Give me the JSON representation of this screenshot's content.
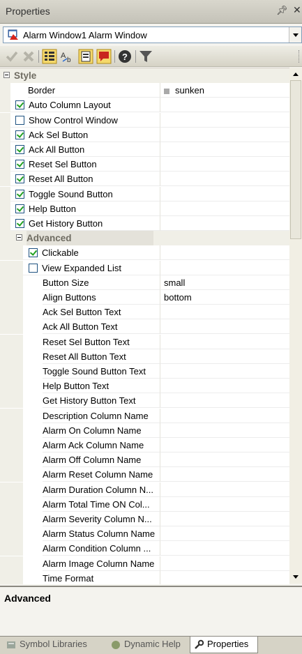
{
  "panel": {
    "title": "Properties",
    "pin_glyph": "p",
    "close_glyph": "×"
  },
  "object_selector": {
    "value": "Alarm Window1 Alarm Window"
  },
  "toolbar": {
    "icons": [
      "check-icon",
      "cross-icon",
      "categorized-icon",
      "alphabetical-icon",
      "properties-icon",
      "events-icon",
      "help-icon",
      "filter-icon"
    ]
  },
  "grid": {
    "style_header": "Style",
    "border_label": "Border",
    "border_value": "sunken",
    "checks": [
      {
        "label": "Auto Column Layout",
        "checked": true
      },
      {
        "label": "Show Control Window",
        "checked": false
      },
      {
        "label": "Ack Sel Button",
        "checked": true
      },
      {
        "label": "Ack All Button",
        "checked": true
      },
      {
        "label": "Reset Sel Button",
        "checked": true
      },
      {
        "label": "Reset All Button",
        "checked": true
      },
      {
        "label": "Toggle Sound Button",
        "checked": true
      },
      {
        "label": "Help Button",
        "checked": true
      },
      {
        "label": "Get History Button",
        "checked": true
      }
    ],
    "advanced_header": "Advanced",
    "adv_checks": [
      {
        "label": "Clickable",
        "checked": true
      },
      {
        "label": "View Expanded List",
        "checked": false
      }
    ],
    "adv_props": [
      {
        "label": "Button Size",
        "value": "small"
      },
      {
        "label": "Align Buttons",
        "value": "bottom"
      },
      {
        "label": "Ack Sel Button Text",
        "value": ""
      },
      {
        "label": "Ack All Button Text",
        "value": ""
      },
      {
        "label": "Reset Sel Button Text",
        "value": ""
      },
      {
        "label": "Reset All Button Text",
        "value": ""
      },
      {
        "label": "Toggle Sound Button Text",
        "value": ""
      },
      {
        "label": "Help Button Text",
        "value": ""
      },
      {
        "label": "Get History Button Text",
        "value": ""
      },
      {
        "label": "Description Column Name",
        "value": ""
      },
      {
        "label": "Alarm On Column Name",
        "value": ""
      },
      {
        "label": "Alarm Ack Column Name",
        "value": ""
      },
      {
        "label": "Alarm Off Column Name",
        "value": ""
      },
      {
        "label": "Alarm Reset Column Name",
        "value": ""
      },
      {
        "label": "Alarm Duration Column N...",
        "value": ""
      },
      {
        "label": "Alarm Total Time ON Col...",
        "value": ""
      },
      {
        "label": "Alarm Severity Column N...",
        "value": ""
      },
      {
        "label": "Alarm Status Column Name",
        "value": ""
      },
      {
        "label": "Alarm Condition Column ...",
        "value": ""
      },
      {
        "label": "Alarm Image Column Name",
        "value": ""
      },
      {
        "label": "Time Format",
        "value": ""
      }
    ]
  },
  "description": {
    "title": "Advanced"
  },
  "tabs": [
    {
      "label": "Symbol Libraries",
      "active": false
    },
    {
      "label": "Dynamic Help",
      "active": false
    },
    {
      "label": "Properties",
      "active": true
    }
  ]
}
